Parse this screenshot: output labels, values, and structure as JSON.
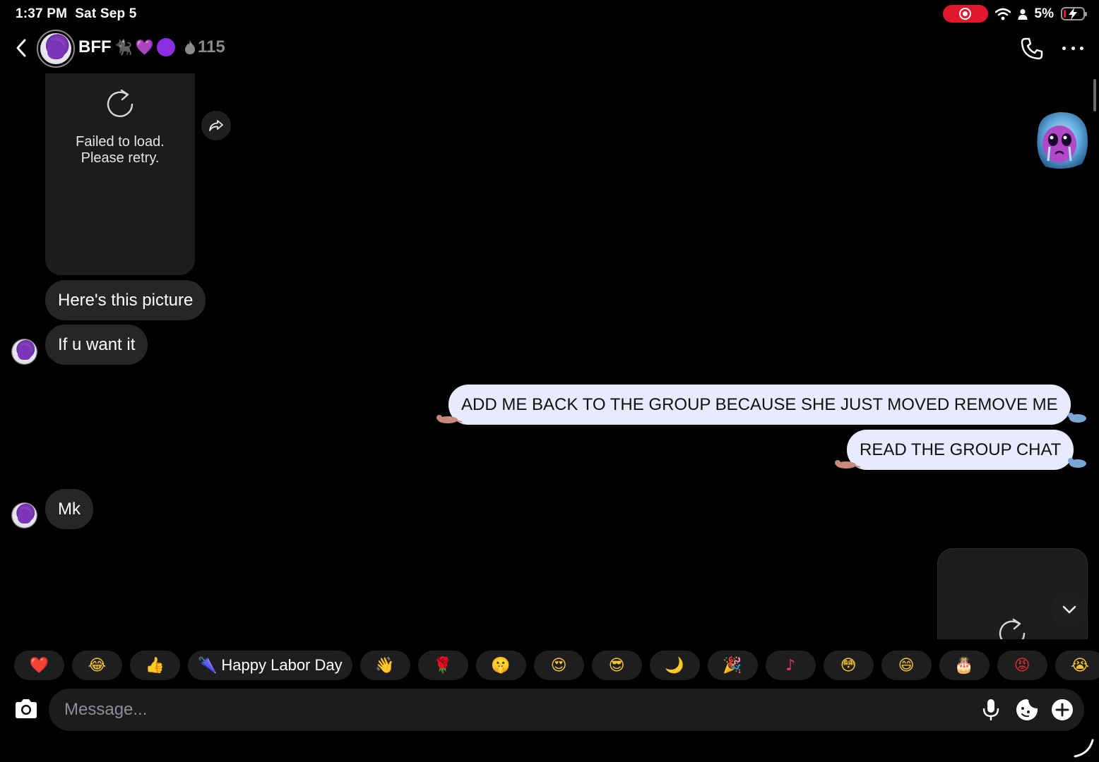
{
  "status_bar": {
    "time": "1:37 PM",
    "date": "Sat Sep 5",
    "battery": "5%",
    "icons": [
      "screen-record-icon",
      "wifi-icon",
      "person-icon",
      "battery-charging-icon"
    ]
  },
  "header": {
    "title": "BFF",
    "title_emojis": [
      "🐈‍⬛",
      "💜"
    ],
    "streak_count": "115",
    "icons": [
      "back-icon",
      "phone-icon",
      "more-icon"
    ]
  },
  "messages": {
    "media_left": {
      "line1": "Failed to load.",
      "line2": "Please retry."
    },
    "incoming_1": "Here's this picture",
    "incoming_2": "If u want it",
    "outgoing_1": "ADD ME BACK TO THE GROUP BECAUSE SHE JUST MOVED REMOVE ME",
    "outgoing_2": "READ THE GROUP CHAT",
    "incoming_3": "Mk"
  },
  "quick_reactions": [
    {
      "emoji": "❤️",
      "label": ""
    },
    {
      "emoji": "😂",
      "label": ""
    },
    {
      "emoji": "👍",
      "label": ""
    },
    {
      "emoji": "🌂",
      "label": "Happy Labor Day"
    },
    {
      "emoji": "👋",
      "label": ""
    },
    {
      "emoji": "🌹",
      "label": ""
    },
    {
      "emoji": "🤫",
      "label": ""
    },
    {
      "emoji": "😍",
      "label": ""
    },
    {
      "emoji": "😎",
      "label": ""
    },
    {
      "emoji": "🌙",
      "label": ""
    },
    {
      "emoji": "🎉",
      "label": ""
    },
    {
      "emoji": "♪",
      "label": ""
    },
    {
      "emoji": "😳",
      "label": ""
    },
    {
      "emoji": "😄",
      "label": ""
    },
    {
      "emoji": "🎂",
      "label": ""
    },
    {
      "emoji": "😡",
      "label": ""
    },
    {
      "emoji": "😭",
      "label": ""
    }
  ],
  "composer": {
    "placeholder": "Message...",
    "icons": [
      "camera-icon",
      "mic-icon",
      "sticker-icon",
      "plus-icon"
    ]
  },
  "colors": {
    "background": "#000000",
    "incoming_bubble": "#262628",
    "outgoing_bubble": "#e8eafe",
    "record_red": "#e2172d"
  }
}
